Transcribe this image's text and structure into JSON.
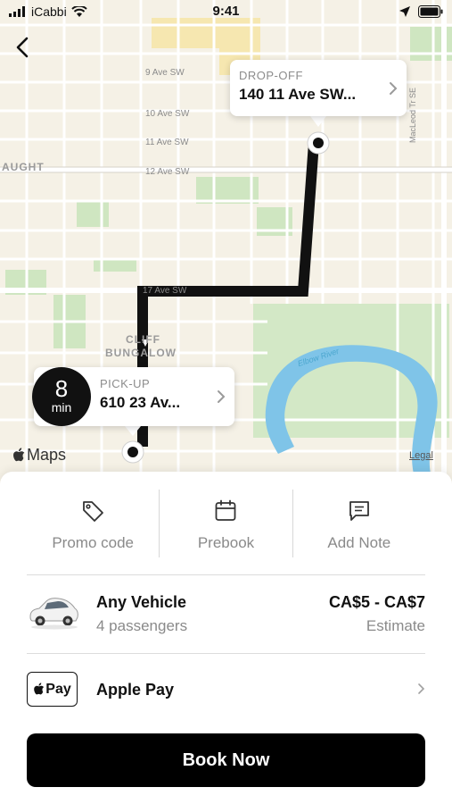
{
  "status_bar": {
    "carrier": "iCabbi",
    "time": "9:41"
  },
  "map": {
    "streets": [
      "9 Ave SW",
      "10 Ave SW",
      "11 Ave SW",
      "12 Ave SW",
      "17 Ave SW",
      "MacLeod Tr SE"
    ],
    "area_labels": [
      "AUGHT",
      "CLIFF",
      "BUNGALOW"
    ],
    "water_label": "Elbow River",
    "maps_brand": "Maps",
    "legal": "Legal",
    "route_color": "#111111",
    "water_color": "#7fc4e8",
    "park_color": "#cfe6c1"
  },
  "dropoff": {
    "label": "DROP-OFF",
    "address": "140 11 Ave SW..."
  },
  "pickup": {
    "label": "PICK-UP",
    "address": "610 23 Av...",
    "eta_value": "8",
    "eta_unit": "min"
  },
  "actions": [
    {
      "label": "Promo code",
      "icon": "tag-icon"
    },
    {
      "label": "Prebook",
      "icon": "calendar-icon"
    },
    {
      "label": "Add Note",
      "icon": "note-icon"
    }
  ],
  "vehicle": {
    "name": "Any Vehicle",
    "passengers": "4 passengers",
    "price": "CA$5 - CA$7",
    "price_note": "Estimate"
  },
  "payment": {
    "badge_text": "Pay",
    "method": "Apple Pay"
  },
  "book_button": "Book Now"
}
